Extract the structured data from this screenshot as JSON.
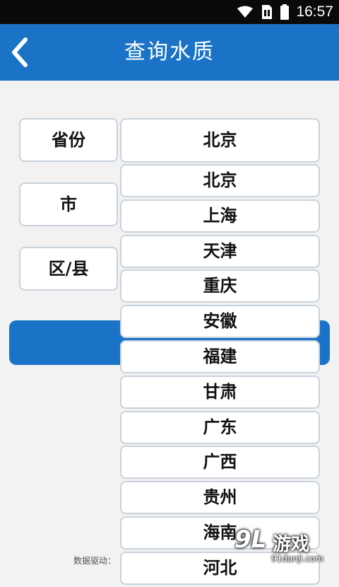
{
  "status_bar": {
    "time": "16:57"
  },
  "header": {
    "title": "查询水质",
    "back_icon": "chevron-left-icon"
  },
  "form": {
    "province_label": "省份",
    "city_label": "市",
    "district_label": "区/县",
    "province_selected": "北京"
  },
  "dropdown": {
    "options": [
      "北京",
      "上海",
      "天津",
      "重庆",
      "安徽",
      "福建",
      "甘肃",
      "广东",
      "广西",
      "贵州",
      "海南",
      "河北"
    ]
  },
  "footer": {
    "data_driver_label": "数据驱动："
  },
  "watermark": {
    "logo": "9L",
    "name": "游戏",
    "url": "91danji.com"
  },
  "colors": {
    "primary": "#1a73c6",
    "status_bar": "#0a0a0a",
    "background": "#f2f2f2",
    "border": "#c9d3dc"
  }
}
